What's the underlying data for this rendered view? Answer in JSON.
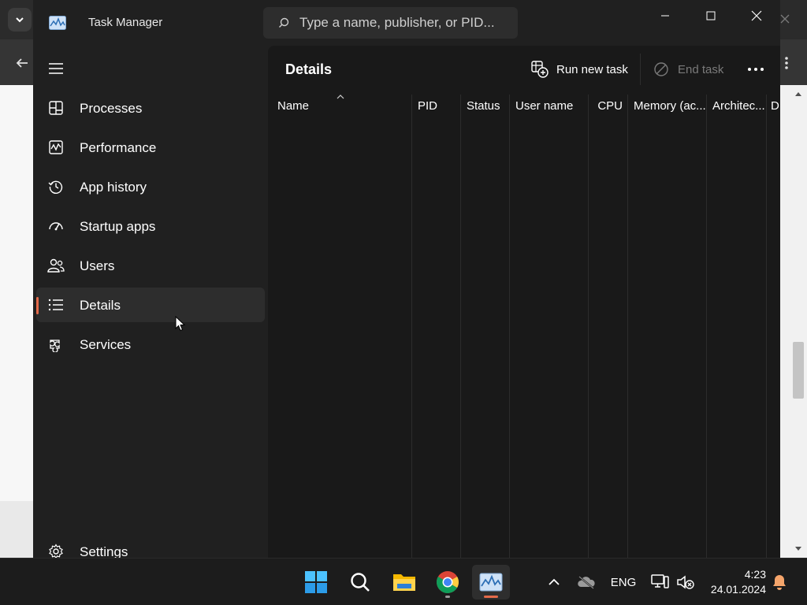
{
  "window": {
    "title": "Task Manager",
    "search_placeholder": "Type a name, publisher, or PID..."
  },
  "sidebar": {
    "items": [
      {
        "label": "Processes",
        "icon": "processes-icon"
      },
      {
        "label": "Performance",
        "icon": "performance-icon"
      },
      {
        "label": "App history",
        "icon": "app-history-icon"
      },
      {
        "label": "Startup apps",
        "icon": "startup-apps-icon"
      },
      {
        "label": "Users",
        "icon": "users-icon"
      },
      {
        "label": "Details",
        "icon": "details-icon",
        "selected": true
      },
      {
        "label": "Services",
        "icon": "services-icon"
      }
    ],
    "settings_label": "Settings"
  },
  "main": {
    "page_title": "Details",
    "run_new_task": "Run new task",
    "end_task": "End task",
    "columns": [
      "Name",
      "PID",
      "Status",
      "User name",
      "CPU",
      "Memory (ac...",
      "Architec...",
      "D"
    ]
  },
  "taskbar": {
    "apps": [
      "start-icon",
      "search-icon",
      "file-explorer-icon",
      "chrome-icon",
      "task-manager-icon"
    ],
    "language": "ENG",
    "time": "4:23",
    "date": "24.01.2024"
  },
  "colors": {
    "accent": "#e46a4a",
    "window_bg": "#202020",
    "content_bg": "#191919"
  }
}
